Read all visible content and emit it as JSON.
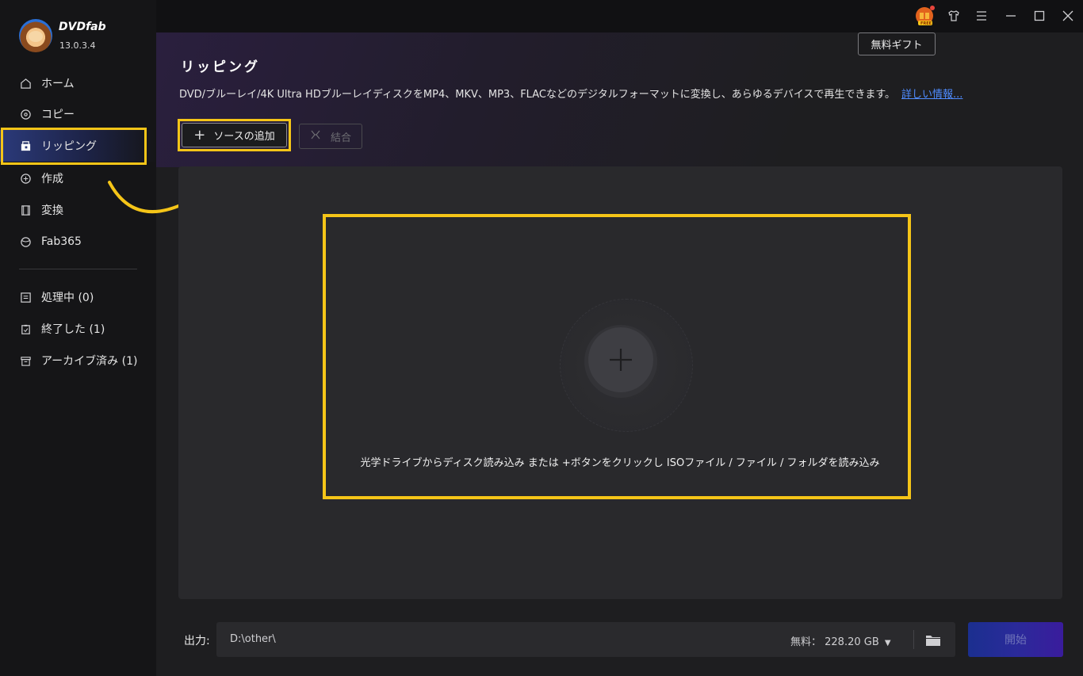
{
  "app": {
    "name": "DVDfab",
    "version": "13.0.3.4"
  },
  "sidebar": {
    "items": [
      {
        "label": "ホーム",
        "icon": "home-icon"
      },
      {
        "label": "コピー",
        "icon": "copy-disc-icon"
      },
      {
        "label": "リッピング",
        "icon": "ripper-icon",
        "active": true
      },
      {
        "label": "作成",
        "icon": "creator-icon"
      },
      {
        "label": "変換",
        "icon": "film-icon"
      },
      {
        "label": "Fab365",
        "icon": "fab365-icon"
      }
    ],
    "queue": [
      {
        "label": "処理中 (0)",
        "icon": "task-list-icon"
      },
      {
        "label": "終了した (1)",
        "icon": "clipboard-check-icon"
      },
      {
        "label": "アーカイブ済み (1)",
        "icon": "archive-icon"
      }
    ]
  },
  "titlebar": {
    "gift_tooltip": "無料ギフト",
    "free_badge": "FREE"
  },
  "main": {
    "title": "リッピング",
    "description": "DVD/ブルーレイ/4K Ultra HDブルーレイディスクをMP4、MKV、MP3、FLACなどのデジタルフォーマットに変換し、あらゆるデバイスで再生できます。",
    "more_link": "詳しい情報...",
    "add_source_label": "ソースの追加",
    "merge_label": "結合",
    "drop_hint": "光学ドライブからディスク読み込み または +ボタンをクリックし ISOファイル / ファイル / フォルダを読み込み"
  },
  "output": {
    "label": "出力:",
    "path": "D:\\other\\",
    "free_space": "無料：  228.20 GB",
    "start_label": "開始"
  },
  "colors": {
    "highlight": "#f5c518",
    "link": "#4f8cff",
    "accent": "#2b3a7a"
  }
}
